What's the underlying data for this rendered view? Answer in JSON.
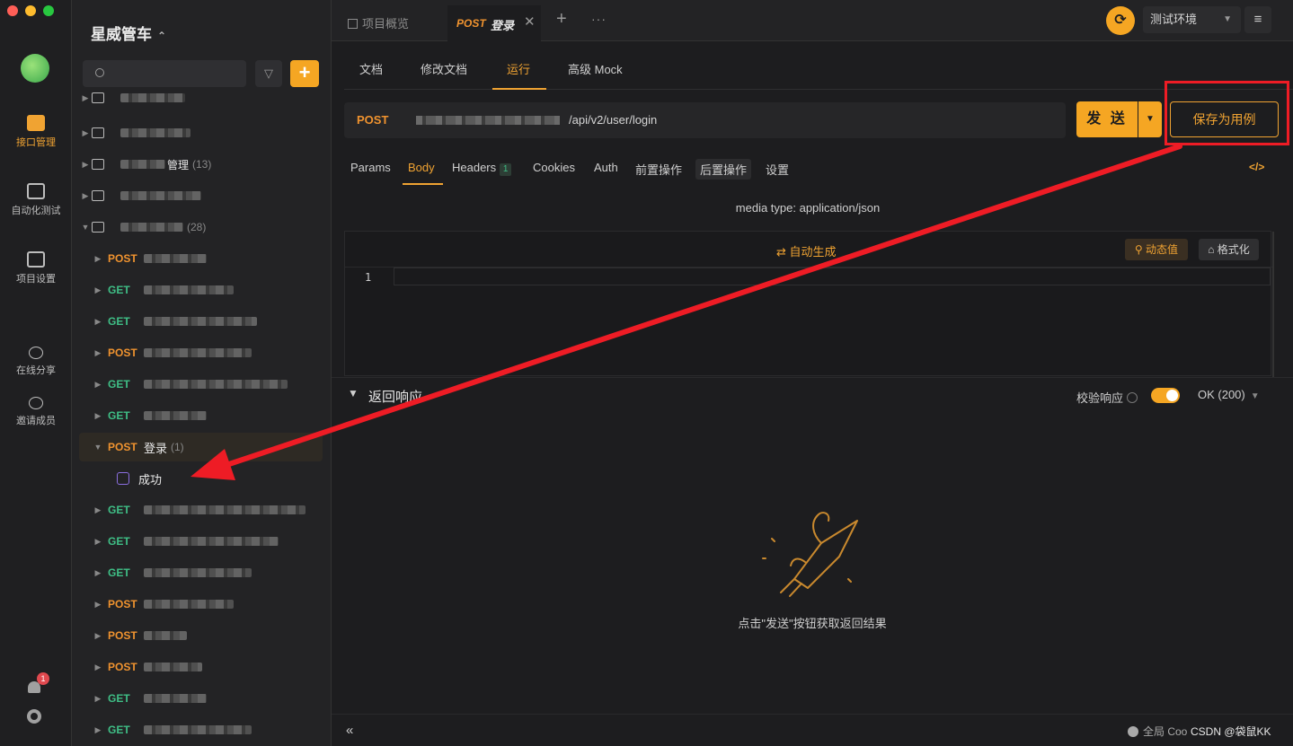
{
  "window": {
    "project_title": "星威管车"
  },
  "rail": {
    "items": [
      {
        "label": "接口管理"
      },
      {
        "label": "自动化测试"
      },
      {
        "label": "项目设置"
      },
      {
        "label": "在线分享"
      },
      {
        "label": "邀请成员"
      }
    ],
    "notification_count": "1"
  },
  "tree": {
    "search_placeholder": "",
    "folder_counts": [
      "(13)",
      "(28)"
    ],
    "folder_label_fragment": "管理",
    "selected_api": {
      "method": "POST",
      "name": "登录",
      "count": "(1)"
    },
    "case_name": "成功",
    "methods": [
      "POST",
      "GET",
      "GET",
      "POST",
      "GET",
      "GET",
      "GET",
      "GET",
      "GET",
      "POST",
      "POST",
      "POST",
      "GET",
      "GET"
    ]
  },
  "tabs": {
    "overview": "项目概览",
    "active_method": "POST",
    "active_name": "登录"
  },
  "env": {
    "name": "测试环境"
  },
  "subtabs": [
    "文档",
    "修改文档",
    "运行",
    "高级 Mock"
  ],
  "request": {
    "method": "POST",
    "path": "/api/v2/user/login",
    "send_label": "发 送",
    "save_case_label": "保存为用例"
  },
  "req_tabs": {
    "params": "Params",
    "body": "Body",
    "headers": "Headers",
    "headers_count": "1",
    "cookies": "Cookies",
    "auth": "Auth",
    "pre": "前置操作",
    "post": "后置操作",
    "settings": "设置",
    "code": "</>"
  },
  "body": {
    "media_type": "media type: application/json",
    "auto_generate": "自动生成",
    "dynamic_value": "动态值",
    "format": "格式化",
    "line_number": "1"
  },
  "response": {
    "title": "返回响应",
    "validate_label": "校验响应",
    "status": "OK (200)",
    "empty_hint": "点击\"发送\"按钮获取返回结果"
  },
  "footer": {
    "cookie_label": "全局 Coo",
    "watermark": "CSDN @袋鼠KK"
  },
  "colors": {
    "accent": "#f5a623",
    "post": "#f0932f",
    "get": "#3fbf86",
    "annotation": "#ee1c25"
  }
}
